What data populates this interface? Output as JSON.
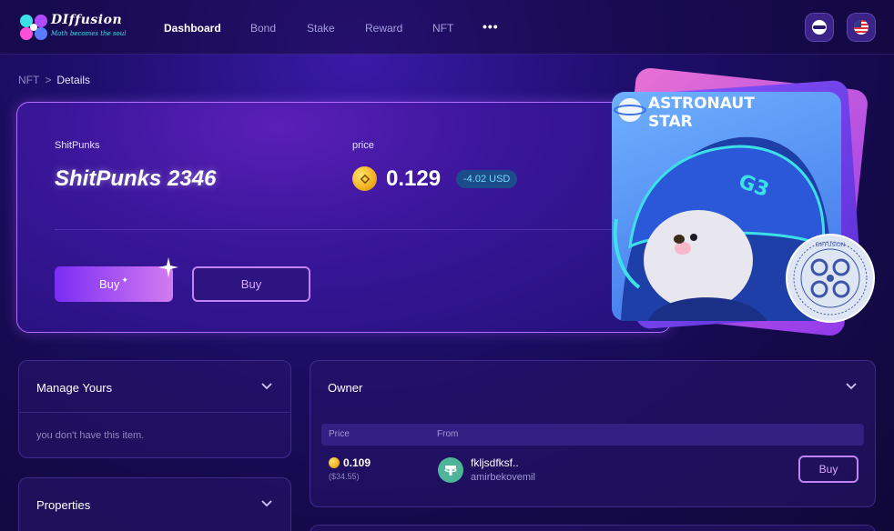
{
  "brand": {
    "name": "DIffusion",
    "tagline": "Math becomes the soul"
  },
  "nav": {
    "items": [
      {
        "label": "Dashboard",
        "active": true
      },
      {
        "label": "Bond",
        "active": false
      },
      {
        "label": "Stake",
        "active": false
      },
      {
        "label": "Reward",
        "active": false
      },
      {
        "label": "NFT",
        "active": false
      }
    ],
    "more": "•••"
  },
  "breadcrumb": {
    "parent": "NFT",
    "separator": ">",
    "current": "Details"
  },
  "hero": {
    "collection_label": "ShitPunks",
    "title": "ShitPunks 2346",
    "price_label": "price",
    "price": "0.129",
    "usd_change": "-4.02 USD",
    "buy_primary": "Buy",
    "buy_secondary": "Buy",
    "art_text_line1": "ASTRONAUT",
    "art_text_line2": "STAR",
    "helmet_text": "G3",
    "seal_text": "DIFFUSION"
  },
  "manage": {
    "title": "Manage Yours",
    "empty_text": "you don't have this item."
  },
  "properties": {
    "title": "Properties"
  },
  "owner": {
    "title": "Owner",
    "columns": {
      "price": "Price",
      "from": "From"
    },
    "rows": [
      {
        "price": "0.109",
        "usd": "($34.55)",
        "name": "fkljsdfksf..",
        "user": "amirbekovemil",
        "action": "Buy"
      }
    ]
  },
  "colors": {
    "accent": "#c084f5",
    "coin": "#f2b01e",
    "usd_badge_text": "#6fd9ff",
    "tether": "#4fb59a"
  },
  "icons": [
    "logo-icon",
    "helmet-icon",
    "us-flag-icon",
    "chevron-down-icon",
    "coin-icon",
    "sparkle-icon",
    "tether-icon",
    "seal-icon"
  ]
}
